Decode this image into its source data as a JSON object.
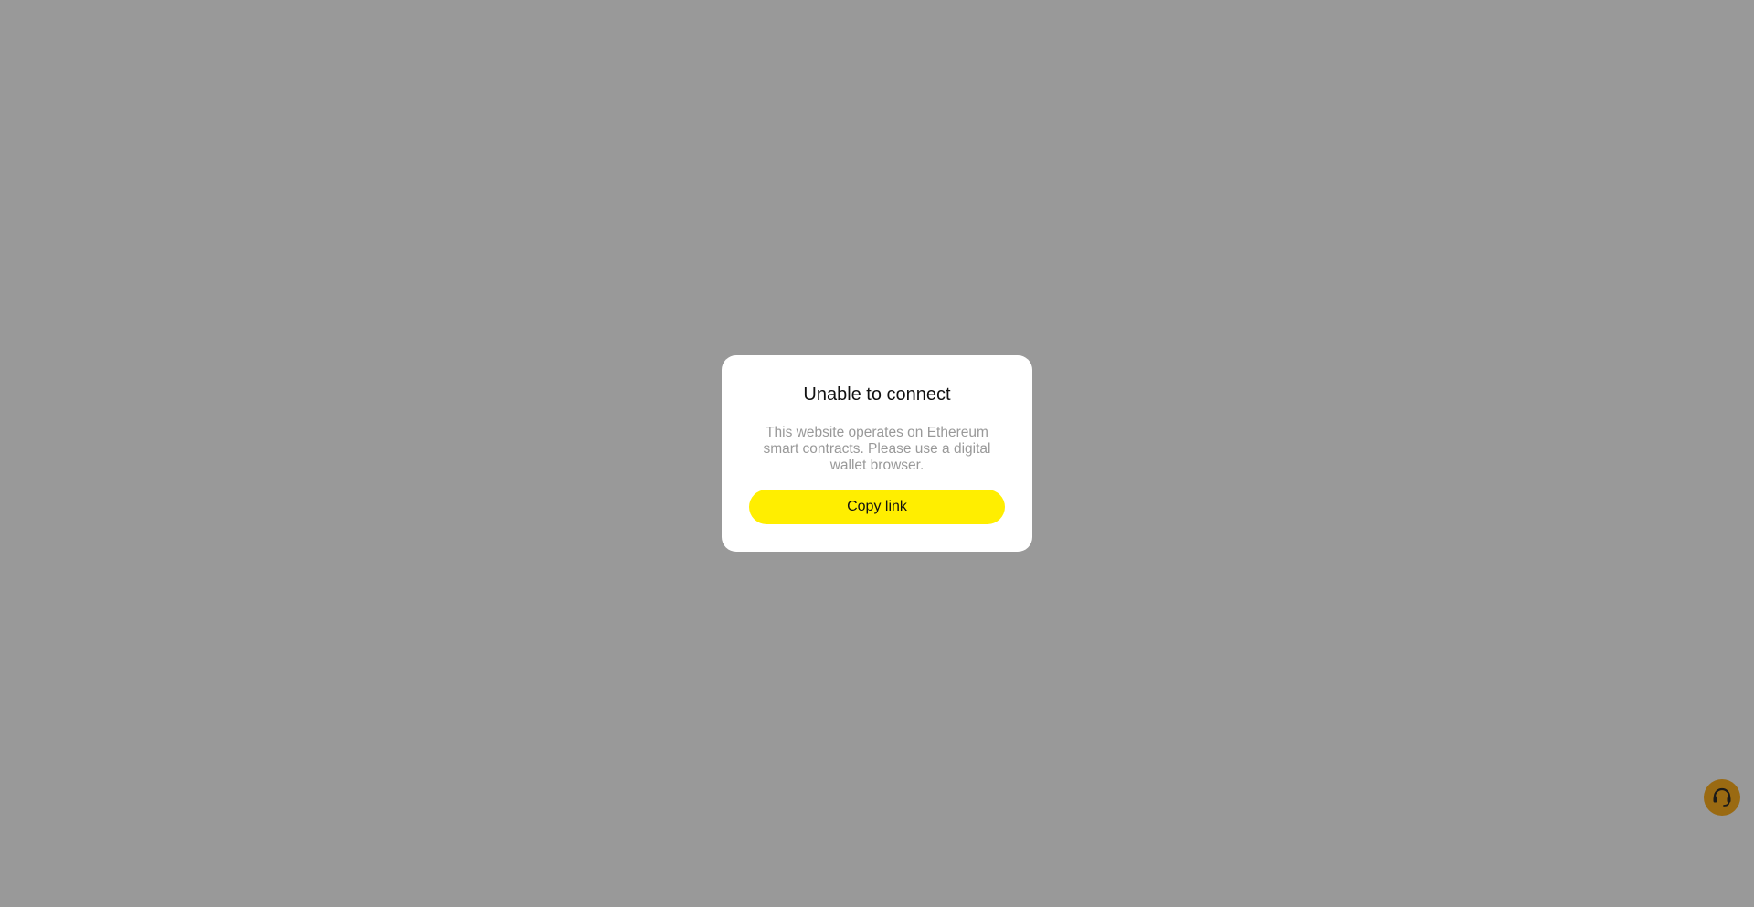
{
  "modal": {
    "title": "Unable to connect",
    "message": "This website operates on Ethereum smart contracts. Please use a digital wallet browser.",
    "copy_label": "Copy link"
  },
  "support": {
    "icon": "headset-icon"
  },
  "colors": {
    "backdrop": "#999999",
    "button_accent": "#ffee00",
    "support_button": "#9a6a12"
  }
}
